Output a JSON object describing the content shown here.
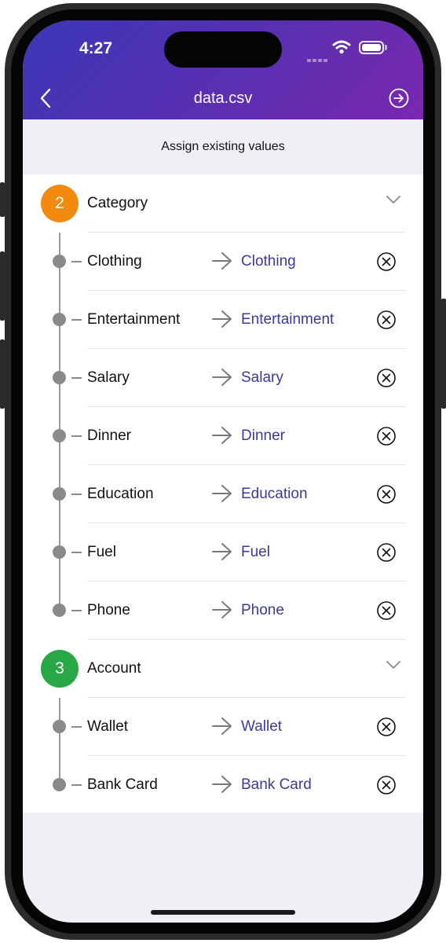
{
  "status_bar": {
    "time": "4:27"
  },
  "nav": {
    "title": "data.csv",
    "back_icon": "chevron-left-icon",
    "export_icon": "arrow-right-circle-icon"
  },
  "subheader": {
    "text": "Assign existing values"
  },
  "colors": {
    "header_start": "#3a37b8",
    "header_end": "#7a28b0",
    "category_badge": "#f28a0f",
    "account_badge": "#27a845",
    "mapped_value": "#3a3a9a"
  },
  "groups": [
    {
      "number": "2",
      "label": "Category",
      "items": [
        {
          "source": "Clothing",
          "target": "Clothing"
        },
        {
          "source": "Entertainment",
          "target": "Entertainment"
        },
        {
          "source": "Salary",
          "target": "Salary"
        },
        {
          "source": "Dinner",
          "target": "Dinner"
        },
        {
          "source": "Education",
          "target": "Education"
        },
        {
          "source": "Fuel",
          "target": "Fuel"
        },
        {
          "source": "Phone",
          "target": "Phone"
        }
      ]
    },
    {
      "number": "3",
      "label": "Account",
      "items": [
        {
          "source": "Wallet",
          "target": "Wallet"
        },
        {
          "source": "Bank Card",
          "target": "Bank Card"
        }
      ]
    }
  ]
}
